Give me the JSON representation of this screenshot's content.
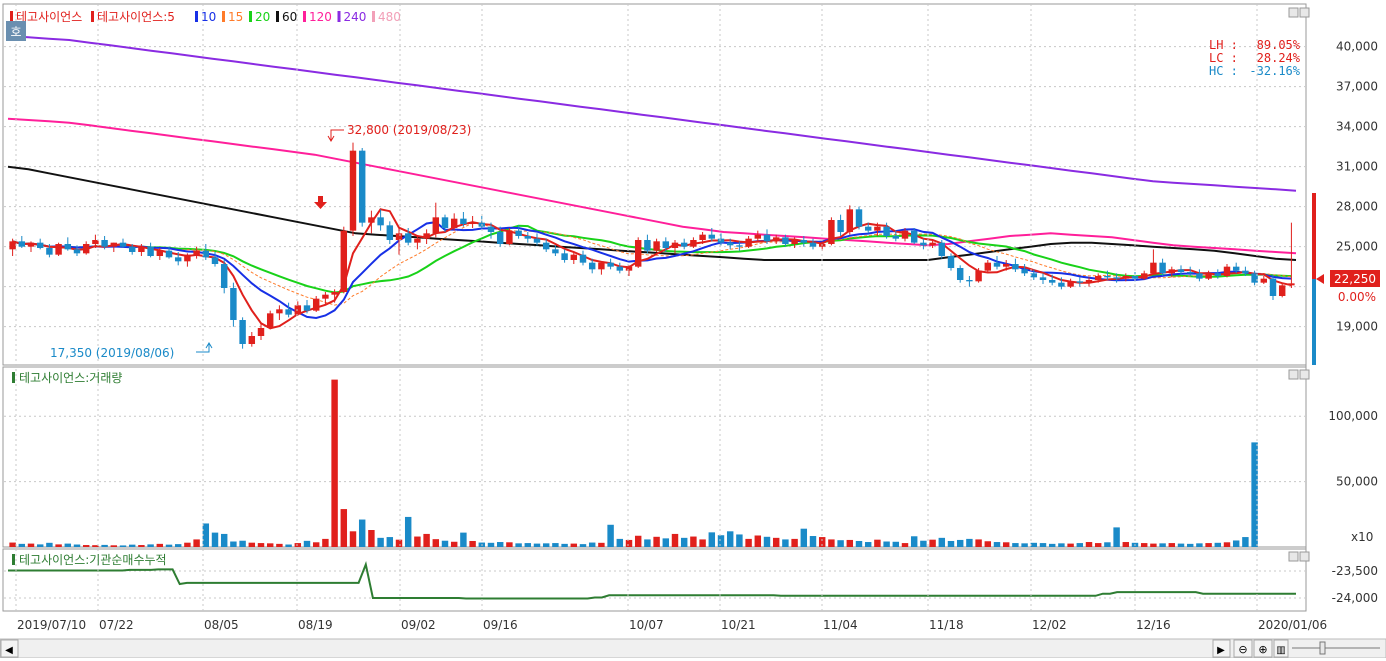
{
  "price_panel": {
    "legend": [
      {
        "label": "테고사이언스",
        "color": "#e0201c"
      },
      {
        "label": "테고사이언스:5",
        "color": "#e0201c"
      },
      {
        "label": "10",
        "color": "#1730e6"
      },
      {
        "label": "15",
        "color": "#ff7b2a"
      },
      {
        "label": "20",
        "color": "#19d219"
      },
      {
        "label": "60",
        "color": "#111111"
      },
      {
        "label": "120",
        "color": "#ff1f9a"
      },
      {
        "label": "240",
        "color": "#8a2be2"
      },
      {
        "label": "480",
        "color": "#f2a0b8"
      }
    ],
    "mode_label": "호",
    "info": [
      {
        "label": "LH :",
        "value": "89.05%",
        "color": "#e0201c"
      },
      {
        "label": "LC :",
        "value": "28.24%",
        "color": "#e0201c"
      },
      {
        "label": "HC :",
        "value": "-32.16%",
        "color": "#1a8ac8"
      }
    ],
    "high_annotation": "32,800 (2019/08/23)",
    "low_annotation": "17,350 (2019/08/06)",
    "current_price": "22,250",
    "current_change": "0.00%",
    "y_ticks": [
      "40,000",
      "37,000",
      "34,000",
      "31,000",
      "28,000",
      "25,000",
      "19,000"
    ]
  },
  "volume_panel": {
    "title": "테고사이언스:거래량",
    "y_ticks": [
      "100,000",
      "50,000"
    ],
    "unit": "x10"
  },
  "inst_panel": {
    "title": "테고사이언스:기관순매수누적",
    "y_ticks": [
      "-23,500",
      "-24,000"
    ]
  },
  "x_axis": {
    "labels": [
      "2019/07/10",
      "07/22",
      "08/05",
      "08/19",
      "09/02",
      "09/16",
      "10/07",
      "10/21",
      "11/04",
      "11/18",
      "12/02",
      "12/16",
      "2020/01/06"
    ]
  },
  "colors": {
    "up": "#e0201c",
    "down": "#1a8ac8",
    "inst": "#2e7d32",
    "grid": "#c8c8c8"
  },
  "chart_data": {
    "type": "candlestick",
    "title": "테고사이언스",
    "ylim": [
      16500,
      42000
    ],
    "candles": [
      [
        24800,
        25600,
        24300,
        25400
      ],
      [
        25400,
        25800,
        24900,
        25000
      ],
      [
        25000,
        25400,
        24600,
        25300
      ],
      [
        25300,
        25600,
        24800,
        24900
      ],
      [
        24900,
        25200,
        24200,
        24400
      ],
      [
        24400,
        25300,
        24300,
        25200
      ],
      [
        25200,
        25700,
        24700,
        24800
      ],
      [
        24800,
        25100,
        24300,
        24500
      ],
      [
        24500,
        25400,
        24400,
        25200
      ],
      [
        25200,
        25900,
        24900,
        25500
      ],
      [
        25500,
        25800,
        24800,
        25000
      ],
      [
        25000,
        25300,
        24600,
        25300
      ],
      [
        25300,
        25600,
        24900,
        25000
      ],
      [
        25000,
        25200,
        24400,
        24600
      ],
      [
        24600,
        25200,
        24300,
        25000
      ],
      [
        25000,
        25300,
        24200,
        24300
      ],
      [
        24300,
        24900,
        24000,
        24700
      ],
      [
        24700,
        25000,
        24100,
        24200
      ],
      [
        24200,
        24600,
        23600,
        23900
      ],
      [
        23900,
        24500,
        23500,
        24400
      ],
      [
        24400,
        25000,
        24100,
        24700
      ],
      [
        24700,
        25200,
        24000,
        24200
      ],
      [
        24200,
        24600,
        23500,
        23700
      ],
      [
        23700,
        24000,
        21500,
        21900
      ],
      [
        21900,
        22300,
        19000,
        19500
      ],
      [
        19500,
        19700,
        17350,
        17700
      ],
      [
        17700,
        18600,
        17500,
        18300
      ],
      [
        18300,
        19200,
        18000,
        18900
      ],
      [
        18900,
        20200,
        18800,
        20000
      ],
      [
        20000,
        20600,
        19500,
        20300
      ],
      [
        20300,
        20800,
        19700,
        19900
      ],
      [
        19900,
        20900,
        19800,
        20600
      ],
      [
        20600,
        21000,
        20000,
        20200
      ],
      [
        20200,
        21300,
        20100,
        21100
      ],
      [
        21100,
        21600,
        20700,
        21400
      ],
      [
        21400,
        21800,
        20800,
        21600
      ],
      [
        21600,
        26500,
        21500,
        26200
      ],
      [
        26200,
        32800,
        25800,
        32200
      ],
      [
        32200,
        32400,
        26500,
        26800
      ],
      [
        26800,
        27700,
        26000,
        27200
      ],
      [
        27200,
        27800,
        26200,
        26600
      ],
      [
        26600,
        26900,
        25200,
        25500
      ],
      [
        25500,
        26400,
        24400,
        26000
      ],
      [
        26000,
        26400,
        25100,
        25300
      ],
      [
        25300,
        25800,
        24800,
        25600
      ],
      [
        25600,
        26300,
        25200,
        26000
      ],
      [
        26000,
        28300,
        25700,
        27200
      ],
      [
        27200,
        27400,
        26100,
        26400
      ],
      [
        26400,
        27500,
        26200,
        27100
      ],
      [
        27100,
        27600,
        26500,
        26700
      ],
      [
        26700,
        27300,
        26400,
        26800
      ],
      [
        26800,
        27300,
        26300,
        26500
      ],
      [
        26500,
        26800,
        25600,
        26100
      ],
      [
        26100,
        26500,
        25000,
        25200
      ],
      [
        25200,
        26400,
        25100,
        26200
      ],
      [
        26200,
        26600,
        25600,
        25800
      ],
      [
        25800,
        26100,
        25300,
        25600
      ],
      [
        25600,
        26000,
        25100,
        25300
      ],
      [
        25300,
        25600,
        24600,
        24800
      ],
      [
        24800,
        25100,
        24300,
        24500
      ],
      [
        24500,
        24800,
        23800,
        24000
      ],
      [
        24000,
        24600,
        23700,
        24400
      ],
      [
        24400,
        24700,
        23600,
        23800
      ],
      [
        23800,
        24100,
        23000,
        23300
      ],
      [
        23300,
        23900,
        22900,
        23800
      ],
      [
        23800,
        24100,
        23300,
        23500
      ],
      [
        23500,
        23800,
        23000,
        23200
      ],
      [
        23200,
        23600,
        22800,
        23500
      ],
      [
        23500,
        25700,
        23400,
        25500
      ],
      [
        25500,
        25900,
        24500,
        24700
      ],
      [
        24700,
        25600,
        24600,
        25400
      ],
      [
        25400,
        25700,
        24600,
        24900
      ],
      [
        24900,
        25500,
        24500,
        25300
      ],
      [
        25300,
        25600,
        24800,
        25000
      ],
      [
        25000,
        25700,
        24900,
        25500
      ],
      [
        25500,
        26100,
        25200,
        25900
      ],
      [
        25900,
        26400,
        25400,
        25600
      ],
      [
        25600,
        26000,
        25100,
        25300
      ],
      [
        25300,
        25600,
        24800,
        25100
      ],
      [
        25100,
        25400,
        24700,
        25000
      ],
      [
        25000,
        25800,
        24900,
        25600
      ],
      [
        25600,
        26200,
        25400,
        25900
      ],
      [
        25900,
        26300,
        25200,
        25400
      ],
      [
        25400,
        25900,
        25200,
        25700
      ],
      [
        25700,
        25900,
        25000,
        25200
      ],
      [
        25200,
        25700,
        24900,
        25500
      ],
      [
        25500,
        25800,
        25000,
        25300
      ],
      [
        25300,
        25600,
        24800,
        25000
      ],
      [
        25000,
        25400,
        24700,
        25200
      ],
      [
        25200,
        27200,
        25100,
        27000
      ],
      [
        27000,
        27400,
        25800,
        26100
      ],
      [
        26100,
        28100,
        25900,
        27800
      ],
      [
        27800,
        28000,
        26300,
        26500
      ],
      [
        26500,
        26800,
        26000,
        26200
      ],
      [
        26200,
        26800,
        25800,
        26500
      ],
      [
        26500,
        26800,
        25600,
        25800
      ],
      [
        25800,
        26200,
        25400,
        25600
      ],
      [
        25600,
        26400,
        25400,
        26200
      ],
      [
        26200,
        26400,
        25200,
        25300
      ],
      [
        25300,
        25600,
        24800,
        25100
      ],
      [
        25100,
        25500,
        24900,
        25300
      ],
      [
        25300,
        25500,
        24100,
        24300
      ],
      [
        24300,
        24500,
        23200,
        23400
      ],
      [
        23400,
        23600,
        22300,
        22500
      ],
      [
        22500,
        22800,
        22000,
        22400
      ],
      [
        22400,
        23400,
        22300,
        23200
      ],
      [
        23200,
        24000,
        23100,
        23800
      ],
      [
        23800,
        24300,
        23300,
        23500
      ],
      [
        23500,
        24000,
        23200,
        23700
      ],
      [
        23700,
        24100,
        23100,
        23300
      ],
      [
        23300,
        23700,
        22800,
        23000
      ],
      [
        23000,
        23300,
        22500,
        22700
      ],
      [
        22700,
        23000,
        22200,
        22500
      ],
      [
        22500,
        22900,
        22100,
        22300
      ],
      [
        22300,
        22700,
        21800,
        22000
      ],
      [
        22000,
        22600,
        21900,
        22400
      ],
      [
        22400,
        22700,
        22000,
        22300
      ],
      [
        22300,
        22700,
        22000,
        22500
      ],
      [
        22500,
        23000,
        22300,
        22800
      ],
      [
        22800,
        23200,
        22500,
        22700
      ],
      [
        22700,
        23000,
        22300,
        22600
      ],
      [
        22600,
        23000,
        22400,
        22800
      ],
      [
        22800,
        23100,
        22400,
        22600
      ],
      [
        22600,
        23200,
        22500,
        23000
      ],
      [
        23000,
        24800,
        22900,
        23800
      ],
      [
        23800,
        24100,
        22800,
        23000
      ],
      [
        23000,
        23500,
        22700,
        23300
      ],
      [
        23300,
        23600,
        22900,
        23100
      ],
      [
        23100,
        23500,
        22800,
        23000
      ],
      [
        23000,
        23300,
        22400,
        22600
      ],
      [
        22600,
        23200,
        22500,
        23000
      ],
      [
        23000,
        23300,
        22600,
        22800
      ],
      [
        22800,
        23700,
        22700,
        23500
      ],
      [
        23500,
        23800,
        23000,
        23200
      ],
      [
        23200,
        23500,
        22800,
        23000
      ],
      [
        23000,
        23200,
        22100,
        22300
      ],
      [
        22300,
        22800,
        22200,
        22600
      ],
      [
        22600,
        22900,
        21000,
        21300
      ],
      [
        21300,
        22300,
        21200,
        22100
      ],
      [
        22100,
        26800,
        21900,
        22250
      ]
    ],
    "volume": [
      340,
      240,
      260,
      200,
      320,
      200,
      260,
      190,
      150,
      140,
      160,
      130,
      120,
      180,
      150,
      200,
      240,
      180,
      220,
      330,
      580,
      1800,
      1100,
      1000,
      420,
      480,
      330,
      300,
      280,
      240,
      190,
      300,
      470,
      360,
      620,
      12800,
      2900,
      1200,
      2100,
      1300,
      700,
      760,
      560,
      2300,
      800,
      1000,
      600,
      480,
      400,
      1100,
      460,
      340,
      320,
      380,
      360,
      280,
      300,
      260,
      280,
      300,
      240,
      260,
      220,
      340,
      320,
      1700,
      620,
      540,
      860,
      580,
      780,
      660,
      1000,
      700,
      800,
      580,
      1120,
      900,
      1200,
      960,
      620,
      880,
      780,
      700,
      580,
      620,
      1400,
      840,
      760,
      580,
      520,
      540,
      460,
      380,
      560,
      420,
      400,
      300,
      820,
      480,
      560,
      700,
      460,
      540,
      620,
      580,
      440,
      380,
      360,
      300,
      280,
      320,
      300,
      240,
      280,
      260,
      300,
      380,
      300,
      360,
      1500,
      380,
      320,
      300,
      260,
      280,
      300,
      260,
      240,
      280,
      300,
      320,
      360,
      500,
      760,
      8000
    ],
    "inst_net_cum": [
      -23490,
      -23490,
      -23490,
      -23490,
      -23490,
      -23490,
      -23490,
      -23490,
      -23490,
      -23490,
      -23490,
      -23490,
      -23490,
      -23490,
      -23490,
      -23490,
      -23490,
      -23480,
      -23480,
      -23480,
      -23480,
      -23470,
      -23470,
      -23470,
      -23740,
      -23720,
      -23720,
      -23720,
      -23720,
      -23720,
      -23720,
      -23720,
      -23720,
      -23720,
      -23720,
      -23720,
      -23720,
      -23720,
      -23720,
      -23720,
      -23720,
      -23720,
      -23720,
      -23720,
      -23720,
      -23720,
      -23720,
      -23720,
      -23720,
      -23720,
      -23380,
      -24000,
      -24000,
      -24000,
      -24000,
      -24000,
      -24000,
      -24000,
      -24000,
      -24000,
      -24000,
      -24000,
      -24000,
      -24000,
      -24010,
      -24010,
      -24010,
      -24010,
      -24010,
      -24010,
      -24010,
      -24010,
      -24010,
      -24010,
      -24010,
      -24010,
      -24010,
      -24010,
      -24010,
      -24010,
      -24010,
      -24010,
      -23990,
      -23990,
      -23950,
      -23950,
      -23950,
      -23950,
      -23950,
      -23950,
      -23950,
      -23950,
      -23950,
      -23950,
      -23950,
      -23950,
      -23950,
      -23950,
      -23950,
      -23950,
      -23950,
      -23950,
      -23950,
      -23950,
      -23950,
      -23950,
      -23950,
      -23950,
      -23960,
      -23960,
      -23960,
      -23960,
      -23960,
      -23960,
      -23960,
      -23960,
      -23960,
      -23960,
      -23960,
      -23960,
      -23960,
      -23960,
      -23960,
      -23960,
      -23960,
      -23960,
      -23960,
      -23960,
      -23960,
      -23960,
      -23960,
      -23960,
      -23960,
      -23960,
      -23960,
      -23960,
      -23960,
      -23960,
      -23960,
      -23960,
      -23960,
      -23960,
      -23960,
      -23960,
      -23960,
      -23960,
      -23960,
      -23960,
      -23960,
      -23960,
      -23960,
      -23960,
      -23960,
      -23920,
      -23920,
      -23890,
      -23890,
      -23890,
      -23890,
      -23890,
      -23890,
      -23890,
      -23890,
      -23890,
      -23890,
      -23890,
      -23890,
      -23920,
      -23920,
      -23920,
      -23920,
      -23920,
      -23920,
      -23920,
      -23920,
      -23920,
      -23920,
      -23920,
      -23920,
      -23920,
      -23920
    ],
    "ma_long": {
      "60": [
        31000,
        30800,
        30500,
        30200,
        29900,
        29600,
        29300,
        29000,
        28700,
        28400,
        28100,
        27800,
        27500,
        27200,
        26900,
        26600,
        26300,
        26000,
        25900,
        25800,
        25700,
        25600,
        25500,
        25400,
        25300,
        25200,
        25100,
        25000,
        24900,
        24800,
        24700,
        24600,
        24500,
        24400,
        24300,
        24200,
        24100,
        24000,
        24000,
        24000,
        24000,
        24000,
        24000,
        24000,
        24000,
        24000,
        24200,
        24400,
        24600,
        24800,
        25000,
        25200,
        25300,
        25300,
        25200,
        25100,
        25000,
        24900,
        24800,
        24700,
        24500,
        24300,
        24100,
        24000
      ],
      "120": [
        34600,
        34500,
        34400,
        34300,
        34100,
        33900,
        33700,
        33500,
        33300,
        33100,
        32900,
        32700,
        32500,
        32300,
        32100,
        31900,
        31600,
        31300,
        31000,
        30700,
        30400,
        30100,
        29800,
        29500,
        29200,
        28900,
        28600,
        28300,
        28000,
        27700,
        27400,
        27100,
        26800,
        26500,
        26300,
        26100,
        26000,
        25900,
        25800,
        25700,
        25600,
        25500,
        25400,
        25300,
        25200,
        25100,
        25200,
        25400,
        25600,
        25800,
        25900,
        26000,
        25900,
        25800,
        25700,
        25500,
        25300,
        25100,
        25000,
        24900,
        24800,
        24700,
        24600,
        24500
      ],
      "240": [
        40800,
        40700,
        40600,
        40500,
        40300,
        40100,
        39900,
        39700,
        39500,
        39300,
        39100,
        38900,
        38700,
        38500,
        38300,
        38100,
        37900,
        37700,
        37500,
        37300,
        37100,
        36900,
        36700,
        36500,
        36300,
        36100,
        35900,
        35700,
        35500,
        35300,
        35100,
        34900,
        34700,
        34500,
        34300,
        34100,
        33900,
        33700,
        33500,
        33300,
        33100,
        32900,
        32700,
        32500,
        32300,
        32100,
        31900,
        31700,
        31500,
        31300,
        31100,
        30900,
        30700,
        30500,
        30300,
        30100,
        29900,
        29800,
        29700,
        29600,
        29500,
        29400,
        29300,
        29200
      ]
    }
  }
}
